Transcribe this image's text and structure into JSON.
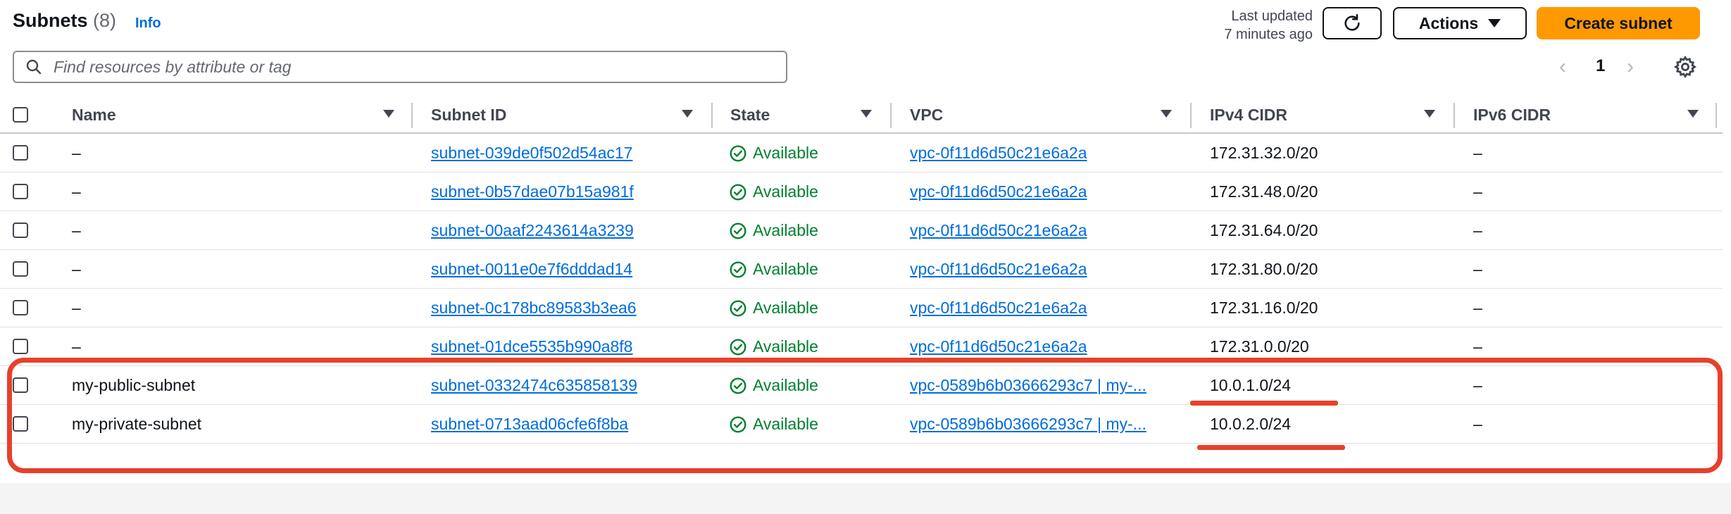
{
  "header": {
    "title": "Subnets",
    "count": "(8)",
    "info_link": "Info",
    "last_updated_line1": "Last updated",
    "last_updated_line2": "7 minutes ago",
    "actions_label": "Actions",
    "create_label": "Create subnet"
  },
  "search": {
    "placeholder": "Find resources by attribute or tag",
    "value": ""
  },
  "pagination": {
    "prev": "‹",
    "page": "1",
    "next": "›"
  },
  "table": {
    "columns": [
      "Name",
      "Subnet ID",
      "State",
      "VPC",
      "IPv4 CIDR",
      "IPv6 CIDR"
    ],
    "rows": [
      {
        "name": "–",
        "subnet_id": "subnet-039de0f502d54ac17",
        "state": "Available",
        "vpc": "vpc-0f11d6d50c21e6a2a",
        "ipv4": "172.31.32.0/20",
        "ipv6": "–"
      },
      {
        "name": "–",
        "subnet_id": "subnet-0b57dae07b15a981f",
        "state": "Available",
        "vpc": "vpc-0f11d6d50c21e6a2a",
        "ipv4": "172.31.48.0/20",
        "ipv6": "–"
      },
      {
        "name": "–",
        "subnet_id": "subnet-00aaf2243614a3239",
        "state": "Available",
        "vpc": "vpc-0f11d6d50c21e6a2a",
        "ipv4": "172.31.64.0/20",
        "ipv6": "–"
      },
      {
        "name": "–",
        "subnet_id": "subnet-0011e0e7f6dddad14",
        "state": "Available",
        "vpc": "vpc-0f11d6d50c21e6a2a",
        "ipv4": "172.31.80.0/20",
        "ipv6": "–"
      },
      {
        "name": "–",
        "subnet_id": "subnet-0c178bc89583b3ea6",
        "state": "Available",
        "vpc": "vpc-0f11d6d50c21e6a2a",
        "ipv4": "172.31.16.0/20",
        "ipv6": "–"
      },
      {
        "name": "–",
        "subnet_id": "subnet-01dce5535b990a8f8",
        "state": "Available",
        "vpc": "vpc-0f11d6d50c21e6a2a",
        "ipv4": "172.31.0.0/20",
        "ipv6": "–"
      },
      {
        "name": "my-public-subnet",
        "subnet_id": "subnet-0332474c635858139",
        "state": "Available",
        "vpc": "vpc-0589b6b03666293c7 | my-...",
        "ipv4": "10.0.1.0/24",
        "ipv6": "–"
      },
      {
        "name": "my-private-subnet",
        "subnet_id": "subnet-0713aad06cfe6f8ba",
        "state": "Available",
        "vpc": "vpc-0589b6b03666293c7 | my-...",
        "ipv4": "10.0.2.0/24",
        "ipv6": "–"
      }
    ]
  },
  "icons": {
    "refresh": "refresh-icon",
    "settings": "gear-icon",
    "search": "search-icon",
    "status": "check-circle-icon"
  },
  "colors": {
    "link": "#006ce0",
    "available": "#00802f",
    "primary_button": "#ff9900",
    "annotation": "#e8402a"
  }
}
